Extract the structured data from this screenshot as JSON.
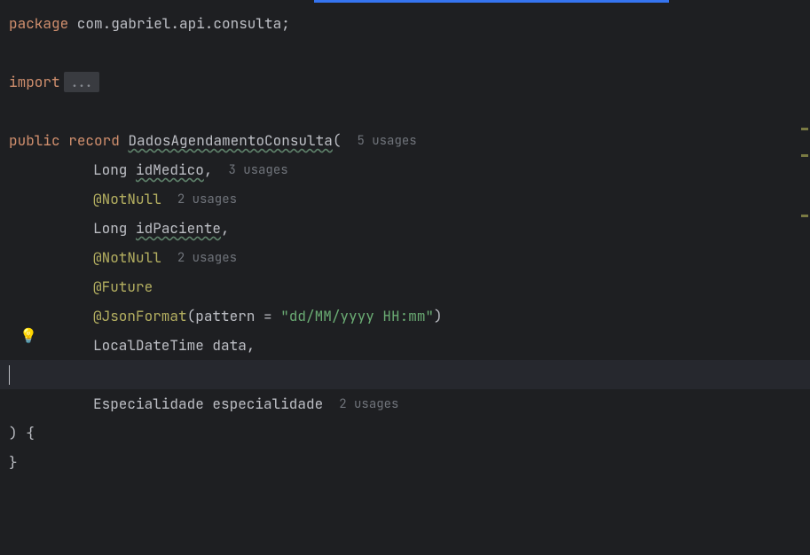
{
  "code": {
    "package_kw": "package",
    "package_name": " com.gabriel.api.consulta",
    "import_kw": "import",
    "folded": "...",
    "public_kw": "public",
    "record_kw": "record",
    "record_name": "DadosAgendamentoConsulta",
    "open_paren": "(",
    "close_paren": ")",
    "record_usages": "5 usages",
    "field1_type": "Long ",
    "field1_name": "idMedico",
    "field1_usages": "3 usages",
    "anno_notnull": "@NotNull",
    "notnull1_usages": "2 usages",
    "field2_type": "Long ",
    "field2_name": "idPaciente",
    "notnull2_usages": "2 usages",
    "anno_future": "@Future",
    "anno_jsonformat": "@JsonFormat",
    "jsonformat_open": "(",
    "pattern_key": "pattern = ",
    "pattern_val": "\"dd/MM/yyyy HH:mm\"",
    "jsonformat_close": ")",
    "field3_type": "LocalDateTime ",
    "field3_name": "data",
    "field4_type": "Especialidade ",
    "field4_name": "especialidade",
    "field4_usages": "2 usages",
    "paren_brace": ") {",
    "close_brace": "}",
    "comma": ",",
    "semicolon": ";"
  }
}
